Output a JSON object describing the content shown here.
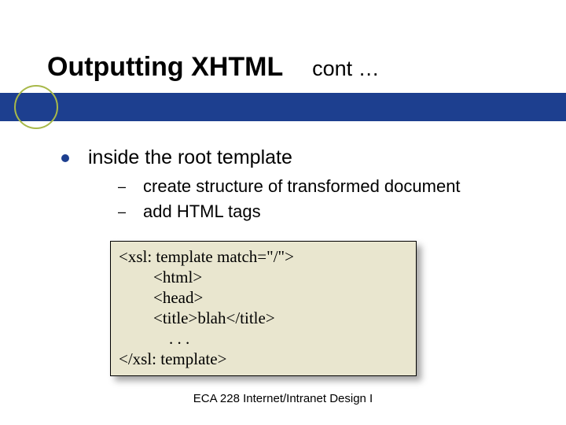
{
  "title": "Outputting XHTML",
  "title_cont": "cont …",
  "bullets": {
    "l1": "inside the root template",
    "l2a": "create structure of transformed document",
    "l2b": "add HTML tags"
  },
  "code": {
    "line1": "<xsl: template  match=\"/\">",
    "line2": "<html>",
    "line3": "<head>",
    "line4": "<title>blah</title>",
    "line5": ". . .",
    "line6": "</xsl: template>"
  },
  "footer": "ECA 228  Internet/Intranet Design I"
}
